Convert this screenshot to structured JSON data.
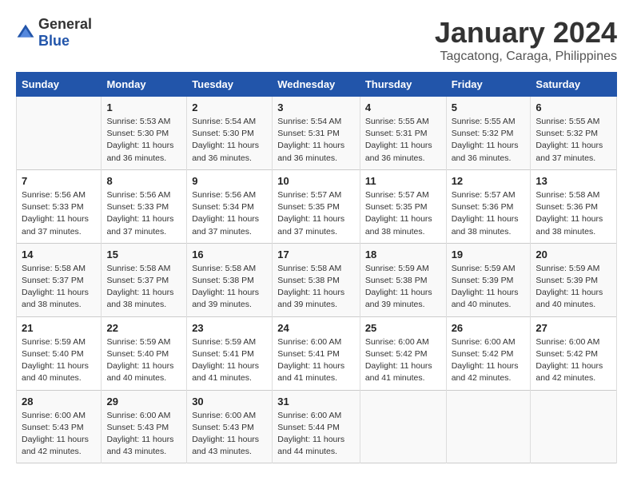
{
  "header": {
    "logo_general": "General",
    "logo_blue": "Blue",
    "title": "January 2024",
    "subtitle": "Tagcatong, Caraga, Philippines"
  },
  "days_of_week": [
    "Sunday",
    "Monday",
    "Tuesday",
    "Wednesday",
    "Thursday",
    "Friday",
    "Saturday"
  ],
  "weeks": [
    [
      {
        "day": "",
        "info": ""
      },
      {
        "day": "1",
        "info": "Sunrise: 5:53 AM\nSunset: 5:30 PM\nDaylight: 11 hours\nand 36 minutes."
      },
      {
        "day": "2",
        "info": "Sunrise: 5:54 AM\nSunset: 5:30 PM\nDaylight: 11 hours\nand 36 minutes."
      },
      {
        "day": "3",
        "info": "Sunrise: 5:54 AM\nSunset: 5:31 PM\nDaylight: 11 hours\nand 36 minutes."
      },
      {
        "day": "4",
        "info": "Sunrise: 5:55 AM\nSunset: 5:31 PM\nDaylight: 11 hours\nand 36 minutes."
      },
      {
        "day": "5",
        "info": "Sunrise: 5:55 AM\nSunset: 5:32 PM\nDaylight: 11 hours\nand 36 minutes."
      },
      {
        "day": "6",
        "info": "Sunrise: 5:55 AM\nSunset: 5:32 PM\nDaylight: 11 hours\nand 37 minutes."
      }
    ],
    [
      {
        "day": "7",
        "info": "Sunrise: 5:56 AM\nSunset: 5:33 PM\nDaylight: 11 hours\nand 37 minutes."
      },
      {
        "day": "8",
        "info": "Sunrise: 5:56 AM\nSunset: 5:33 PM\nDaylight: 11 hours\nand 37 minutes."
      },
      {
        "day": "9",
        "info": "Sunrise: 5:56 AM\nSunset: 5:34 PM\nDaylight: 11 hours\nand 37 minutes."
      },
      {
        "day": "10",
        "info": "Sunrise: 5:57 AM\nSunset: 5:35 PM\nDaylight: 11 hours\nand 37 minutes."
      },
      {
        "day": "11",
        "info": "Sunrise: 5:57 AM\nSunset: 5:35 PM\nDaylight: 11 hours\nand 38 minutes."
      },
      {
        "day": "12",
        "info": "Sunrise: 5:57 AM\nSunset: 5:36 PM\nDaylight: 11 hours\nand 38 minutes."
      },
      {
        "day": "13",
        "info": "Sunrise: 5:58 AM\nSunset: 5:36 PM\nDaylight: 11 hours\nand 38 minutes."
      }
    ],
    [
      {
        "day": "14",
        "info": "Sunrise: 5:58 AM\nSunset: 5:37 PM\nDaylight: 11 hours\nand 38 minutes."
      },
      {
        "day": "15",
        "info": "Sunrise: 5:58 AM\nSunset: 5:37 PM\nDaylight: 11 hours\nand 38 minutes."
      },
      {
        "day": "16",
        "info": "Sunrise: 5:58 AM\nSunset: 5:38 PM\nDaylight: 11 hours\nand 39 minutes."
      },
      {
        "day": "17",
        "info": "Sunrise: 5:58 AM\nSunset: 5:38 PM\nDaylight: 11 hours\nand 39 minutes."
      },
      {
        "day": "18",
        "info": "Sunrise: 5:59 AM\nSunset: 5:38 PM\nDaylight: 11 hours\nand 39 minutes."
      },
      {
        "day": "19",
        "info": "Sunrise: 5:59 AM\nSunset: 5:39 PM\nDaylight: 11 hours\nand 40 minutes."
      },
      {
        "day": "20",
        "info": "Sunrise: 5:59 AM\nSunset: 5:39 PM\nDaylight: 11 hours\nand 40 minutes."
      }
    ],
    [
      {
        "day": "21",
        "info": "Sunrise: 5:59 AM\nSunset: 5:40 PM\nDaylight: 11 hours\nand 40 minutes."
      },
      {
        "day": "22",
        "info": "Sunrise: 5:59 AM\nSunset: 5:40 PM\nDaylight: 11 hours\nand 40 minutes."
      },
      {
        "day": "23",
        "info": "Sunrise: 5:59 AM\nSunset: 5:41 PM\nDaylight: 11 hours\nand 41 minutes."
      },
      {
        "day": "24",
        "info": "Sunrise: 6:00 AM\nSunset: 5:41 PM\nDaylight: 11 hours\nand 41 minutes."
      },
      {
        "day": "25",
        "info": "Sunrise: 6:00 AM\nSunset: 5:42 PM\nDaylight: 11 hours\nand 41 minutes."
      },
      {
        "day": "26",
        "info": "Sunrise: 6:00 AM\nSunset: 5:42 PM\nDaylight: 11 hours\nand 42 minutes."
      },
      {
        "day": "27",
        "info": "Sunrise: 6:00 AM\nSunset: 5:42 PM\nDaylight: 11 hours\nand 42 minutes."
      }
    ],
    [
      {
        "day": "28",
        "info": "Sunrise: 6:00 AM\nSunset: 5:43 PM\nDaylight: 11 hours\nand 42 minutes."
      },
      {
        "day": "29",
        "info": "Sunrise: 6:00 AM\nSunset: 5:43 PM\nDaylight: 11 hours\nand 43 minutes."
      },
      {
        "day": "30",
        "info": "Sunrise: 6:00 AM\nSunset: 5:43 PM\nDaylight: 11 hours\nand 43 minutes."
      },
      {
        "day": "31",
        "info": "Sunrise: 6:00 AM\nSunset: 5:44 PM\nDaylight: 11 hours\nand 44 minutes."
      },
      {
        "day": "",
        "info": ""
      },
      {
        "day": "",
        "info": ""
      },
      {
        "day": "",
        "info": ""
      }
    ]
  ]
}
